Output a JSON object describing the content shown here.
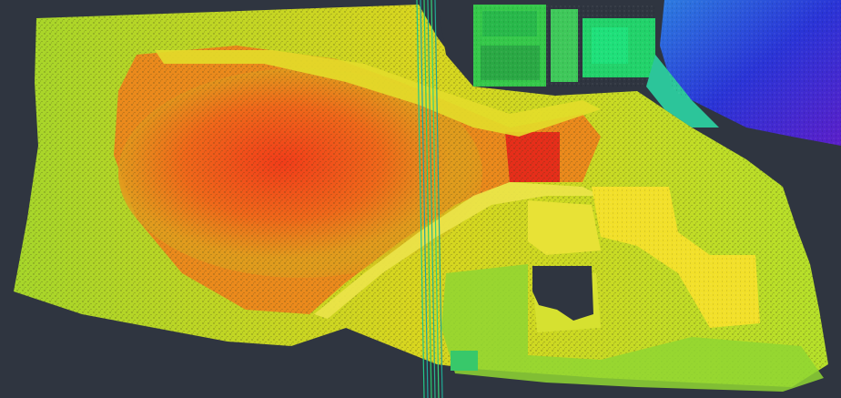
{
  "view": {
    "background": "#2f3540",
    "colormap": [
      "#1b1bd6",
      "#2f7fe0",
      "#19d27a",
      "#7fe020",
      "#c8e41e",
      "#f2e21a",
      "#f6a21a",
      "#f4661a",
      "#f03a1a"
    ]
  }
}
